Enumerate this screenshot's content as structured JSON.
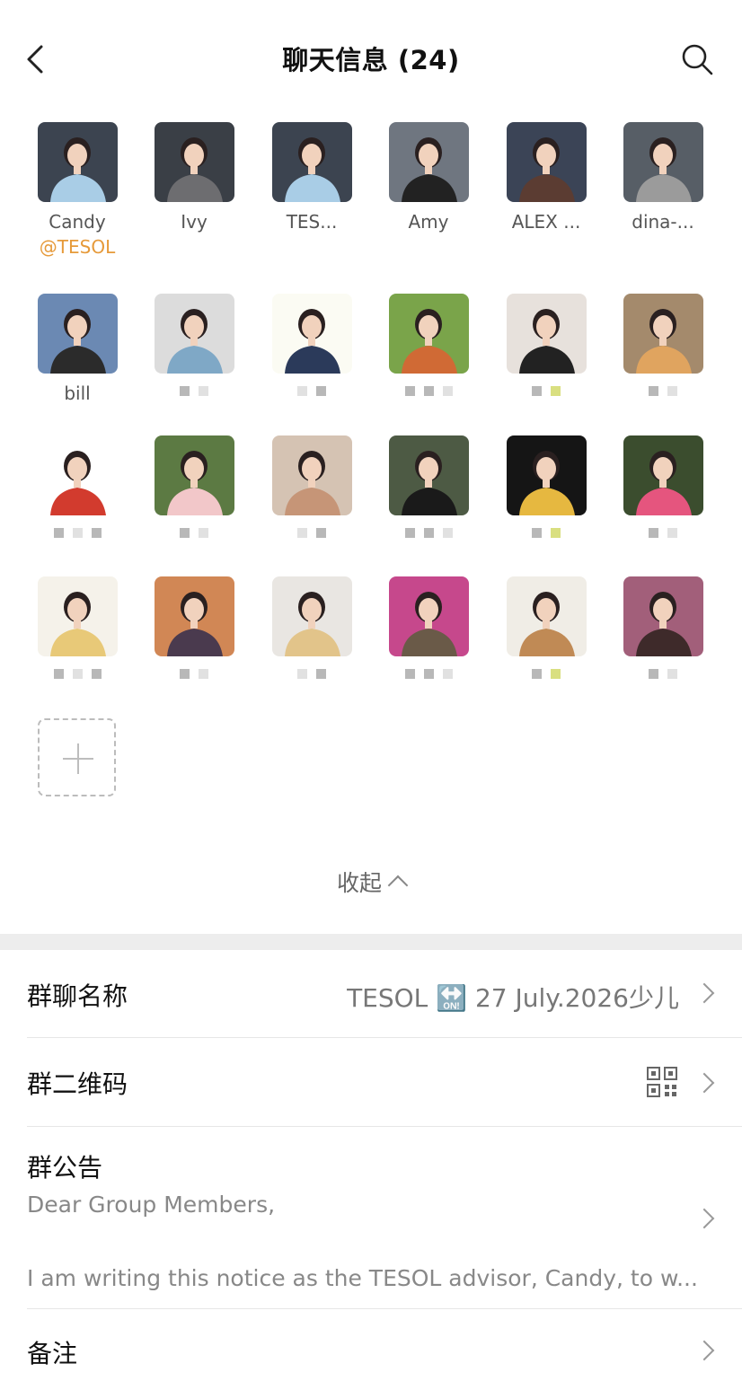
{
  "header": {
    "title": "聊天信息 (24)"
  },
  "members": [
    {
      "name": "Candy",
      "tag": "@TESOL",
      "bg": "#3c4450",
      "shirt": "#a9cde6"
    },
    {
      "name": "Ivy",
      "tag": "",
      "bg": "#3a3f46",
      "shirt": "#6d6d70"
    },
    {
      "name": "TES...",
      "tag": "",
      "bg": "#3c4450",
      "shirt": "#a9cde6"
    },
    {
      "name": "Amy",
      "tag": "",
      "bg": "#6f7680",
      "shirt": "#222222"
    },
    {
      "name": "ALEX ...",
      "tag": "",
      "bg": "#3b4456",
      "shirt": "#5b3c32"
    },
    {
      "name": "dina-...",
      "tag": "",
      "bg": "#575e66",
      "shirt": "#9b9b9b"
    },
    {
      "name": "bill",
      "tag": "",
      "bg": "#6b89b3",
      "shirt": "#2b2b2b"
    },
    {
      "name": "",
      "tag": "",
      "bg": "#dcdcdc",
      "shirt": "#7fa8c6"
    },
    {
      "name": "",
      "tag": "",
      "bg": "#fbfbf3",
      "shirt": "#2b3a5a"
    },
    {
      "name": "",
      "tag": "",
      "bg": "#7aa44a",
      "shirt": "#d06a35"
    },
    {
      "name": "",
      "tag": "",
      "bg": "#e7e1dc",
      "shirt": "#222222"
    },
    {
      "name": "",
      "tag": "",
      "bg": "#a48a6c",
      "shirt": "#e0a45f"
    },
    {
      "name": "",
      "tag": "",
      "bg": "#ffffff",
      "shirt": "#d23b2e"
    },
    {
      "name": "",
      "tag": "",
      "bg": "#5c7a43",
      "shirt": "#f2c7c9"
    },
    {
      "name": "",
      "tag": "",
      "bg": "#d5c3b3",
      "shirt": "#c69577"
    },
    {
      "name": "",
      "tag": "",
      "bg": "#4d5a44",
      "shirt": "#1a1a1a"
    },
    {
      "name": "",
      "tag": "",
      "bg": "#151515",
      "shirt": "#e6b840"
    },
    {
      "name": "",
      "tag": "",
      "bg": "#3b4d2e",
      "shirt": "#e5557e"
    },
    {
      "name": "",
      "tag": "",
      "bg": "#f5f2ea",
      "shirt": "#e8c978"
    },
    {
      "name": "",
      "tag": "",
      "bg": "#d18755",
      "shirt": "#4a3a4e"
    },
    {
      "name": "",
      "tag": "",
      "bg": "#e9e6e2",
      "shirt": "#e2c48a"
    },
    {
      "name": "",
      "tag": "",
      "bg": "#c6488c",
      "shirt": "#6a5a48"
    },
    {
      "name": "",
      "tag": "",
      "bg": "#f0ede6",
      "shirt": "#c08a55"
    },
    {
      "name": "",
      "tag": "",
      "bg": "#a25f7a",
      "shirt": "#3e2a2a"
    }
  ],
  "collapse_label": "收起",
  "group_name": {
    "label": "群聊名称",
    "value": "TESOL 🔛 27 July.2026少儿"
  },
  "group_qr": {
    "label": "群二维码"
  },
  "notice": {
    "label": "群公告",
    "line1": "Dear Group Members,",
    "line2": "I am writing this notice as the TESOL advisor, Candy, to w..."
  },
  "remark": {
    "label": "备注"
  },
  "colors": {
    "accent_tag": "#e69a3a",
    "divider": "#ededed"
  }
}
